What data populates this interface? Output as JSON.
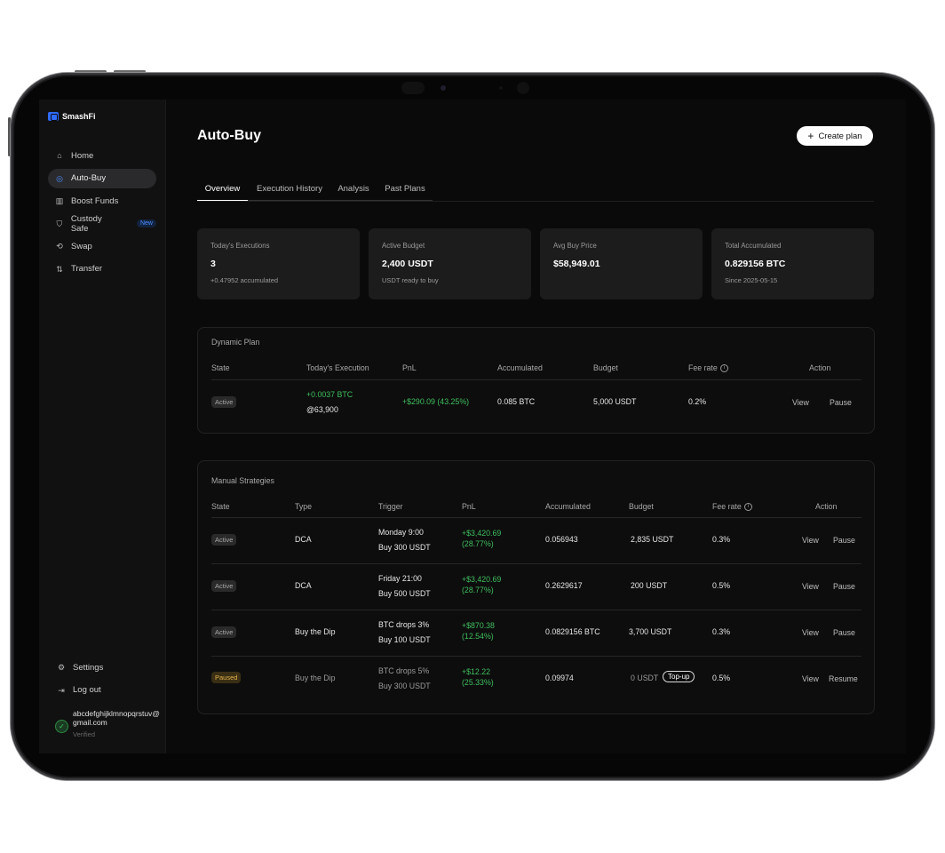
{
  "app": {
    "name": "SmashFi"
  },
  "sidebar": {
    "items": [
      {
        "label": "Home",
        "icon": "home-icon"
      },
      {
        "label": "Auto-Buy",
        "icon": "robot-icon"
      },
      {
        "label": "Boost Funds",
        "icon": "chart-icon"
      },
      {
        "label": "Custody Safe",
        "icon": "shield-icon",
        "badge": "New"
      },
      {
        "label": "Swap",
        "icon": "swap-icon"
      },
      {
        "label": "Transfer",
        "icon": "transfer-icon"
      }
    ],
    "bottom": [
      {
        "label": "Settings",
        "icon": "gear-icon"
      },
      {
        "label": "Log out",
        "icon": "logout-icon"
      }
    ],
    "user": {
      "email": "abcdefghijklmnopqrstuv@gmail.com",
      "status": "Verified"
    }
  },
  "header": {
    "title": "Auto-Buy",
    "create_label": "Create plan"
  },
  "tabs": [
    "Overview",
    "Execution History",
    "Analysis",
    "Past Plans"
  ],
  "stats": [
    {
      "label": "Today's Executions",
      "value": "3",
      "sub": "+0.47952 accumulated"
    },
    {
      "label": "Active Budget",
      "value": "2,400 USDT",
      "sub": "USDT ready to buy"
    },
    {
      "label": "Avg Buy Price",
      "value": "$58,949.01",
      "sub": ""
    },
    {
      "label": "Total Accumulated",
      "value": "0.829156 BTC",
      "sub": "Since 2025-05-15"
    }
  ],
  "dynamic_plan": {
    "title": "Dynamic Plan",
    "headers": [
      "State",
      "Today's Execution",
      "PnL",
      "Accumulated",
      "Budget",
      "Fee rate",
      "Action"
    ],
    "row": {
      "state": "Active",
      "execution_amount": "+0.0037 BTC",
      "execution_price": "@63,900",
      "pnl": "+$290.09 (43.25%)",
      "accumulated": "0.085 BTC",
      "budget": "5,000 USDT",
      "fee": "0.2%",
      "actions": [
        "View",
        "Pause"
      ]
    }
  },
  "manual": {
    "title": "Manual Strategies",
    "headers": [
      "State",
      "Type",
      "Trigger",
      "PnL",
      "Accumulated",
      "Budget",
      "Fee rate",
      "Action"
    ],
    "rows": [
      {
        "state": "Active",
        "type": "DCA",
        "trigger1": "Monday 9:00",
        "trigger2": "Buy 300 USDT",
        "pnl1": "+$3,420.69",
        "pnl2": "(28.77%)",
        "accumulated": "0.056943",
        "budget": "2,835 USDT",
        "fee": "0.3%",
        "a1": "View",
        "a2": "Pause"
      },
      {
        "state": "Active",
        "type": "DCA",
        "trigger1": "Friday 21:00",
        "trigger2": "Buy 500 USDT",
        "pnl1": "+$3,420.69",
        "pnl2": "(28.77%)",
        "accumulated": "0.2629617",
        "budget": "200 USDT",
        "fee": "0.5%",
        "a1": "View",
        "a2": "Pause"
      },
      {
        "state": "Active",
        "type": "Buy the Dip",
        "trigger1": "BTC drops 3%",
        "trigger2": "Buy 100 USDT",
        "pnl1": "+$870.38",
        "pnl2": "(12.54%)",
        "accumulated": "0.0829156 BTC",
        "budget": "3,700 USDT",
        "fee": "0.3%",
        "a1": "View",
        "a2": "Pause"
      },
      {
        "state": "Paused",
        "type": "Buy the Dip",
        "trigger1": "BTC drops 5%",
        "trigger2": "Buy 300 USDT",
        "pnl1": "+$12.22",
        "pnl2": "(25.33%)",
        "accumulated": "0.09974",
        "budget": "0 USDT",
        "topup": "Top-up",
        "fee": "0.5%",
        "a1": "View",
        "a2": "Resume"
      }
    ]
  }
}
